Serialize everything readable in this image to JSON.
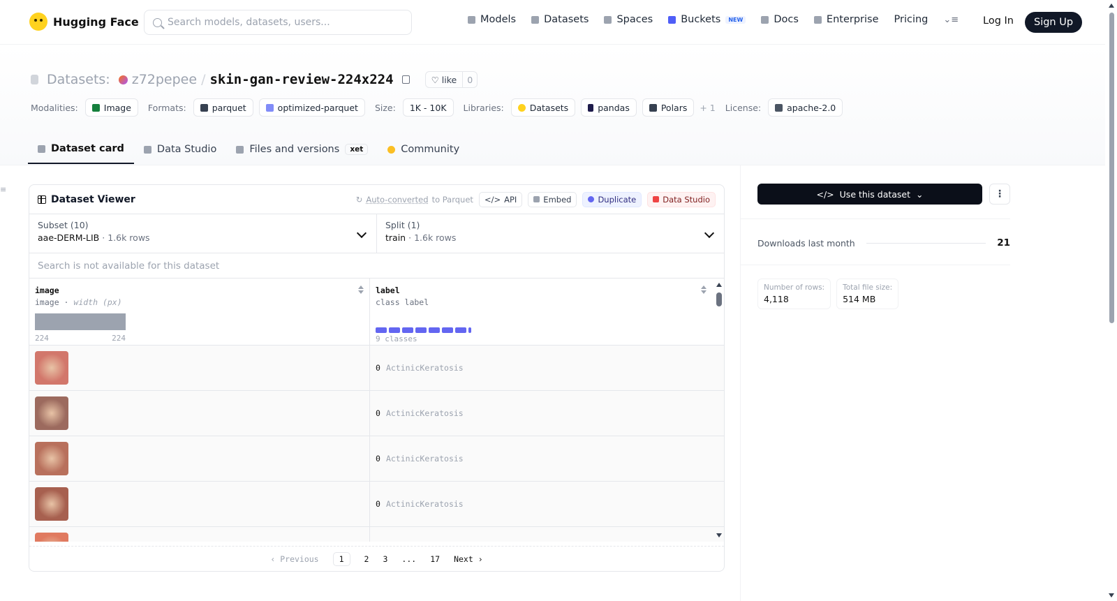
{
  "brand": {
    "name": "Hugging Face"
  },
  "search": {
    "placeholder": "Search models, datasets, users..."
  },
  "nav": {
    "items": [
      {
        "label": "Models",
        "icon": "cube-icon"
      },
      {
        "label": "Datasets",
        "icon": "database-icon"
      },
      {
        "label": "Spaces",
        "icon": "grid-icon"
      },
      {
        "label": "Buckets",
        "icon": "bucket-icon",
        "badge": "NEW"
      },
      {
        "label": "Docs",
        "icon": "book-icon"
      },
      {
        "label": "Enterprise",
        "icon": "enterprise-icon"
      },
      {
        "label": "Pricing"
      }
    ],
    "login": "Log In",
    "signup": "Sign Up"
  },
  "dataset": {
    "prefix": "Datasets:",
    "owner": "z72pepee",
    "separator": "/",
    "name": "skin-gan-review-224x224",
    "like_label": "like",
    "like_count": "0"
  },
  "meta": {
    "modalities_label": "Modalities:",
    "modality": "Image",
    "formats_label": "Formats:",
    "formats": [
      "parquet",
      "optimized-parquet"
    ],
    "size_label": "Size:",
    "size": "1K - 10K",
    "libraries_label": "Libraries:",
    "libraries": [
      "Datasets",
      "pandas",
      "Polars"
    ],
    "libraries_more": "+ 1",
    "license_label": "License:",
    "license": "apache-2.0"
  },
  "tabs": [
    {
      "label": "Dataset card",
      "active": true
    },
    {
      "label": "Data Studio"
    },
    {
      "label": "Files and versions",
      "badge": "xet"
    },
    {
      "label": "Community"
    }
  ],
  "viewer": {
    "title": "Dataset Viewer",
    "auto_converted": "Auto-converted",
    "auto_suffix": "to Parquet",
    "actions": {
      "api": "API",
      "embed": "Embed",
      "duplicate": "Duplicate",
      "data_studio": "Data Studio"
    },
    "subset": {
      "title": "Subset (10)",
      "value": "aae-DERM-LIB",
      "rows": "1.6k rows"
    },
    "split": {
      "title": "Split (1)",
      "value": "train",
      "rows": "1.6k rows"
    },
    "search_disabled": "Search is not available for this dataset",
    "columns": [
      {
        "name": "image",
        "type": "image",
        "subtype": "width (px)",
        "min": "224",
        "max": "224"
      },
      {
        "name": "label",
        "type": "class label",
        "classes": "9 classes"
      }
    ],
    "rows": [
      {
        "class_id": "0",
        "class_name": "ActinicKeratosis",
        "color": "#d2776b"
      },
      {
        "class_id": "0",
        "class_name": "ActinicKeratosis",
        "color": "#9c6a5e"
      },
      {
        "class_id": "0",
        "class_name": "ActinicKeratosis",
        "color": "#b8705c"
      },
      {
        "class_id": "0",
        "class_name": "ActinicKeratosis",
        "color": "#a7604f"
      },
      {
        "class_id": "",
        "class_name": "",
        "color": "#e07a60"
      }
    ],
    "pager": {
      "previous": "Previous",
      "pages": [
        "1",
        "2",
        "3",
        "...",
        "17"
      ],
      "current": "1",
      "next": "Next"
    }
  },
  "sidebar": {
    "use_button": "Use this dataset",
    "downloads_label": "Downloads last month",
    "downloads_value": "21",
    "stats": [
      {
        "label": "Number of rows:",
        "value": "4,118"
      },
      {
        "label": "Total file size:",
        "value": "514 MB"
      }
    ]
  },
  "colors": {
    "accent_dark": "#0b0f19",
    "class_bar": "#6366f1",
    "brand_yellow": "#ffd21e"
  }
}
